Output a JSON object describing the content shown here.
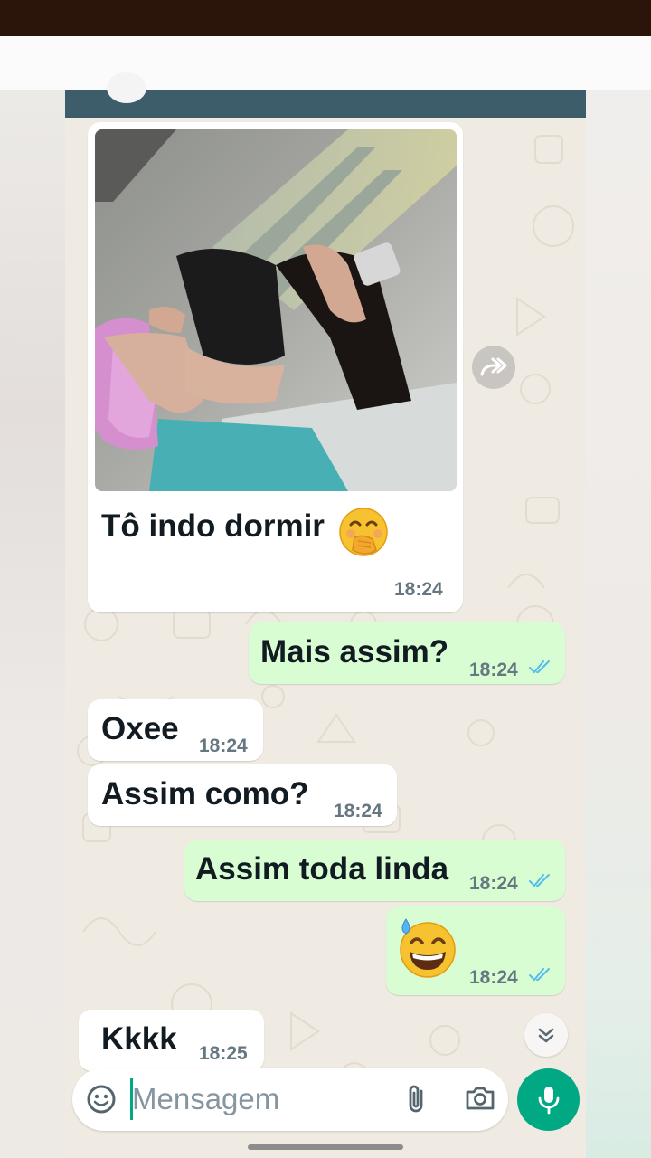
{
  "colors": {
    "incoming_bubble": "#ffffff",
    "outgoing_bubble": "#d9fdd3",
    "read_ticks": "#53bdeb",
    "accent": "#00a884",
    "header": "#3d5d6a"
  },
  "messages": [
    {
      "direction": "incoming",
      "type": "image",
      "caption": "Tô indo dormir",
      "emoji": "face-with-hand-over-mouth",
      "time": "18:24"
    },
    {
      "direction": "outgoing",
      "text": "Mais assim?",
      "time": "18:24",
      "status": "read"
    },
    {
      "direction": "incoming",
      "text": "Oxee",
      "time": "18:24"
    },
    {
      "direction": "incoming",
      "text": "Assim como?",
      "time": "18:24"
    },
    {
      "direction": "outgoing",
      "text": "Assim toda linda",
      "time": "18:24",
      "status": "read"
    },
    {
      "direction": "outgoing",
      "type": "emoji",
      "emoji": "grinning-face-with-sweat",
      "time": "18:24",
      "status": "read"
    },
    {
      "direction": "incoming",
      "text": "Kkkk",
      "time": "18:25"
    }
  ],
  "composer": {
    "placeholder": "Mensagem",
    "icons": [
      "emoji-icon",
      "attach-icon",
      "camera-icon",
      "mic-icon"
    ]
  },
  "chat_icons": [
    "forward-icon",
    "scroll-down-icon"
  ]
}
